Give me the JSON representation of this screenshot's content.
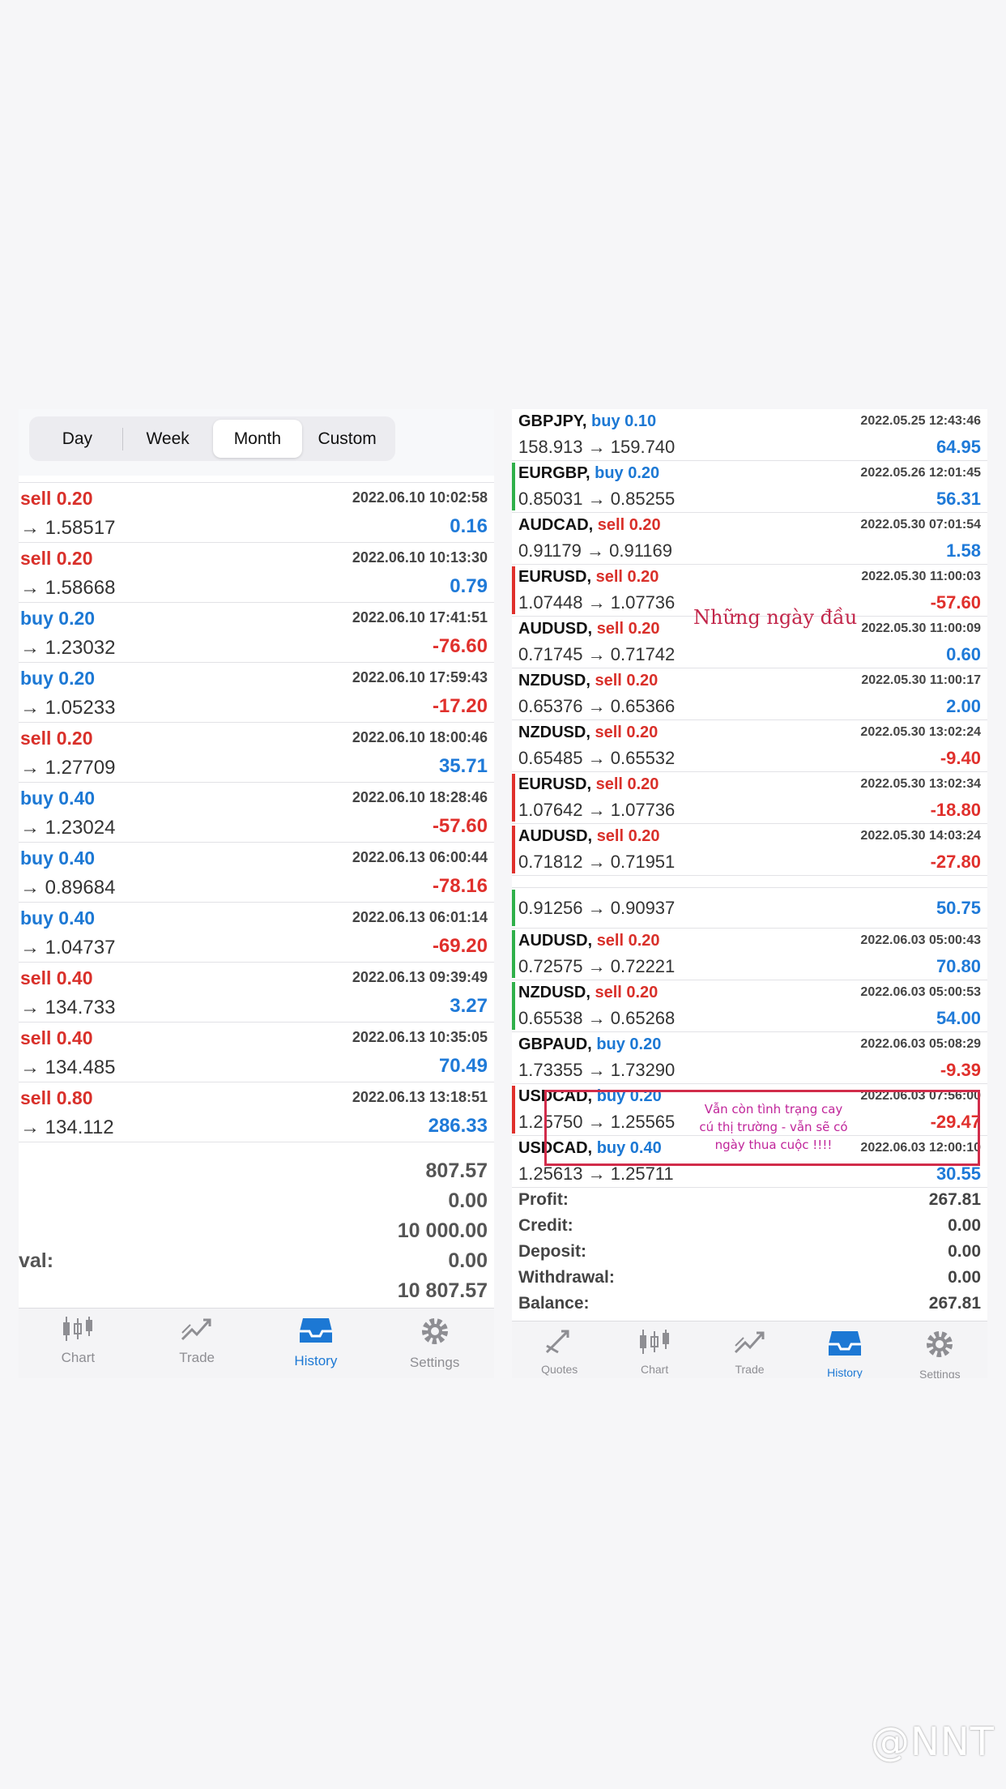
{
  "left_panel": {
    "periods": [
      "Day",
      "Week",
      "Month",
      "Custom"
    ],
    "active_period": "Month",
    "rows": [
      {
        "side": "sell",
        "lot": "sell 0.20",
        "prices": "→ 1.58517",
        "time": "2022.06.10 10:02:58",
        "profit": "0.16"
      },
      {
        "side": "sell",
        "lot": "sell 0.20",
        "prices": "→ 1.58668",
        "time": "2022.06.10 10:13:30",
        "profit": "0.79"
      },
      {
        "side": "buy",
        "lot": "buy 0.20",
        "prices": "→ 1.23032",
        "time": "2022.06.10 17:41:51",
        "profit": "-76.60"
      },
      {
        "side": "buy",
        "lot": "buy 0.20",
        "prices": "→ 1.05233",
        "time": "2022.06.10 17:59:43",
        "profit": "-17.20"
      },
      {
        "side": "sell",
        "lot": "sell 0.20",
        "prices": "→ 1.27709",
        "time": "2022.06.10 18:00:46",
        "profit": "35.71"
      },
      {
        "side": "buy",
        "lot": "buy 0.40",
        "prices": "→ 1.23024",
        "time": "2022.06.10 18:28:46",
        "profit": "-57.60"
      },
      {
        "side": "buy",
        "lot": "buy 0.40",
        "prices": "→ 0.89684",
        "time": "2022.06.13 06:00:44",
        "profit": "-78.16"
      },
      {
        "side": "buy",
        "lot": "buy 0.40",
        "prices": "→ 1.04737",
        "time": "2022.06.13 06:01:14",
        "profit": "-69.20"
      },
      {
        "side": "sell",
        "lot": "sell 0.40",
        "prices": "→ 134.733",
        "time": "2022.06.13 09:39:49",
        "profit": "3.27"
      },
      {
        "side": "sell",
        "lot": "sell 0.40",
        "prices": "→ 134.485",
        "time": "2022.06.13 10:35:05",
        "profit": "70.49"
      },
      {
        "side": "sell",
        "lot": "sell 0.80",
        "prices": "→ 134.112",
        "time": "2022.06.13 13:18:51",
        "profit": "286.33"
      }
    ],
    "summary": [
      {
        "label": "",
        "value": "807.57"
      },
      {
        "label": "",
        "value": "0.00"
      },
      {
        "label": "",
        "value": "10 000.00"
      },
      {
        "label": "val:",
        "value": "0.00"
      },
      {
        "label": "",
        "value": "10 807.57"
      }
    ],
    "tabs": [
      {
        "label": "Chart",
        "icon": "candlestick-icon",
        "active": false
      },
      {
        "label": "Trade",
        "icon": "trade-icon",
        "active": false
      },
      {
        "label": "History",
        "icon": "history-inbox-icon",
        "active": true
      },
      {
        "label": "Settings",
        "icon": "gear-icon",
        "active": false
      }
    ]
  },
  "right_panel": {
    "rows_top": [
      {
        "symbol": "GBPJPY,",
        "side": "buy",
        "lot": "buy 0.10",
        "prices": "158.913 → 159.740",
        "time": "2022.05.25 12:43:46",
        "profit": "64.95",
        "marker": ""
      },
      {
        "symbol": "EURGBP,",
        "side": "buy",
        "lot": "buy 0.20",
        "prices": "0.85031 → 0.85255",
        "time": "2022.05.26 12:01:45",
        "profit": "56.31",
        "marker": "#2fb04a"
      },
      {
        "symbol": "AUDCAD,",
        "side": "sell",
        "lot": "sell 0.20",
        "prices": "0.91179 → 0.91169",
        "time": "2022.05.30 07:01:54",
        "profit": "1.58",
        "marker": ""
      },
      {
        "symbol": "EURUSD,",
        "side": "sell",
        "lot": "sell 0.20",
        "prices": "1.07448 → 1.07736",
        "time": "2022.05.30 11:00:03",
        "profit": "-57.60",
        "marker": "#e0302c"
      },
      {
        "symbol": "AUDUSD,",
        "side": "sell",
        "lot": "sell 0.20",
        "prices": "0.71745 → 0.71742",
        "time": "2022.05.30 11:00:09",
        "profit": "0.60",
        "marker": ""
      },
      {
        "symbol": "NZDUSD,",
        "side": "sell",
        "lot": "sell 0.20",
        "prices": "0.65376 → 0.65366",
        "time": "2022.05.30 11:00:17",
        "profit": "2.00",
        "marker": ""
      },
      {
        "symbol": "NZDUSD,",
        "side": "sell",
        "lot": "sell 0.20",
        "prices": "0.65485 → 0.65532",
        "time": "2022.05.30 13:02:24",
        "profit": "-9.40",
        "marker": ""
      },
      {
        "symbol": "EURUSD,",
        "side": "sell",
        "lot": "sell 0.20",
        "prices": "1.07642 → 1.07736",
        "time": "2022.05.30 13:02:34",
        "profit": "-18.80",
        "marker": "#e0302c"
      },
      {
        "symbol": "AUDUSD,",
        "side": "sell",
        "lot": "sell 0.20",
        "prices": "0.71812 → 0.71951",
        "time": "2022.05.30 14:03:24",
        "profit": "-27.80",
        "marker": "#e0302c"
      }
    ],
    "rows_bottom": [
      {
        "symbol": "",
        "side": "",
        "lot": "",
        "prices": "0.91256 → 0.90937",
        "time": "",
        "profit": "50.75",
        "marker": "#2fb04a"
      },
      {
        "symbol": "AUDUSD,",
        "side": "sell",
        "lot": "sell 0.20",
        "prices": "0.72575 → 0.72221",
        "time": "2022.06.03 05:00:43",
        "profit": "70.80",
        "marker": "#2fb04a"
      },
      {
        "symbol": "NZDUSD,",
        "side": "sell",
        "lot": "sell 0.20",
        "prices": "0.65538 → 0.65268",
        "time": "2022.06.03 05:00:53",
        "profit": "54.00",
        "marker": "#2fb04a"
      },
      {
        "symbol": "GBPAUD,",
        "side": "buy",
        "lot": "buy 0.20",
        "prices": "1.73355 → 1.73290",
        "time": "2022.06.03 05:08:29",
        "profit": "-9.39",
        "marker": ""
      },
      {
        "symbol": "USDCAD,",
        "side": "buy",
        "lot": "buy 0.20",
        "prices": "1.25750 → 1.25565",
        "time": "2022.06.03 07:56:00",
        "profit": "-29.47",
        "marker": "#e0302c"
      },
      {
        "symbol": "USDCAD,",
        "side": "buy",
        "lot": "buy 0.40",
        "prices": "1.25613 → 1.25711",
        "time": "2022.06.03 12:00:10",
        "profit": "30.55",
        "marker": ""
      }
    ],
    "summary": [
      {
        "label": "Profit:",
        "value": "267.81"
      },
      {
        "label": "Credit:",
        "value": "0.00"
      },
      {
        "label": "Deposit:",
        "value": "0.00"
      },
      {
        "label": "Withdrawal:",
        "value": "0.00"
      },
      {
        "label": "Balance:",
        "value": "267.81"
      }
    ],
    "tabs": [
      {
        "label": "Quotes",
        "icon": "quotes-icon",
        "active": false
      },
      {
        "label": "Chart",
        "icon": "candlestick-icon",
        "active": false
      },
      {
        "label": "Trade",
        "icon": "trade-icon",
        "active": false
      },
      {
        "label": "History",
        "icon": "history-inbox-icon",
        "active": true
      },
      {
        "label": "Settings",
        "icon": "gear-icon",
        "active": false
      }
    ]
  },
  "annotations": {
    "note1": "Những ngày đầu",
    "note2": "Vẫn còn tình trạng cay cú thị trường - vẫn sẽ có ngày thua cuộc !!!!",
    "watermark": "@NNT"
  },
  "colors": {
    "sell": "#d9302a",
    "buy": "#1c78d4",
    "negative": "#e0302c",
    "positive": "#1f7ad8",
    "accent": "#1c78d4"
  }
}
